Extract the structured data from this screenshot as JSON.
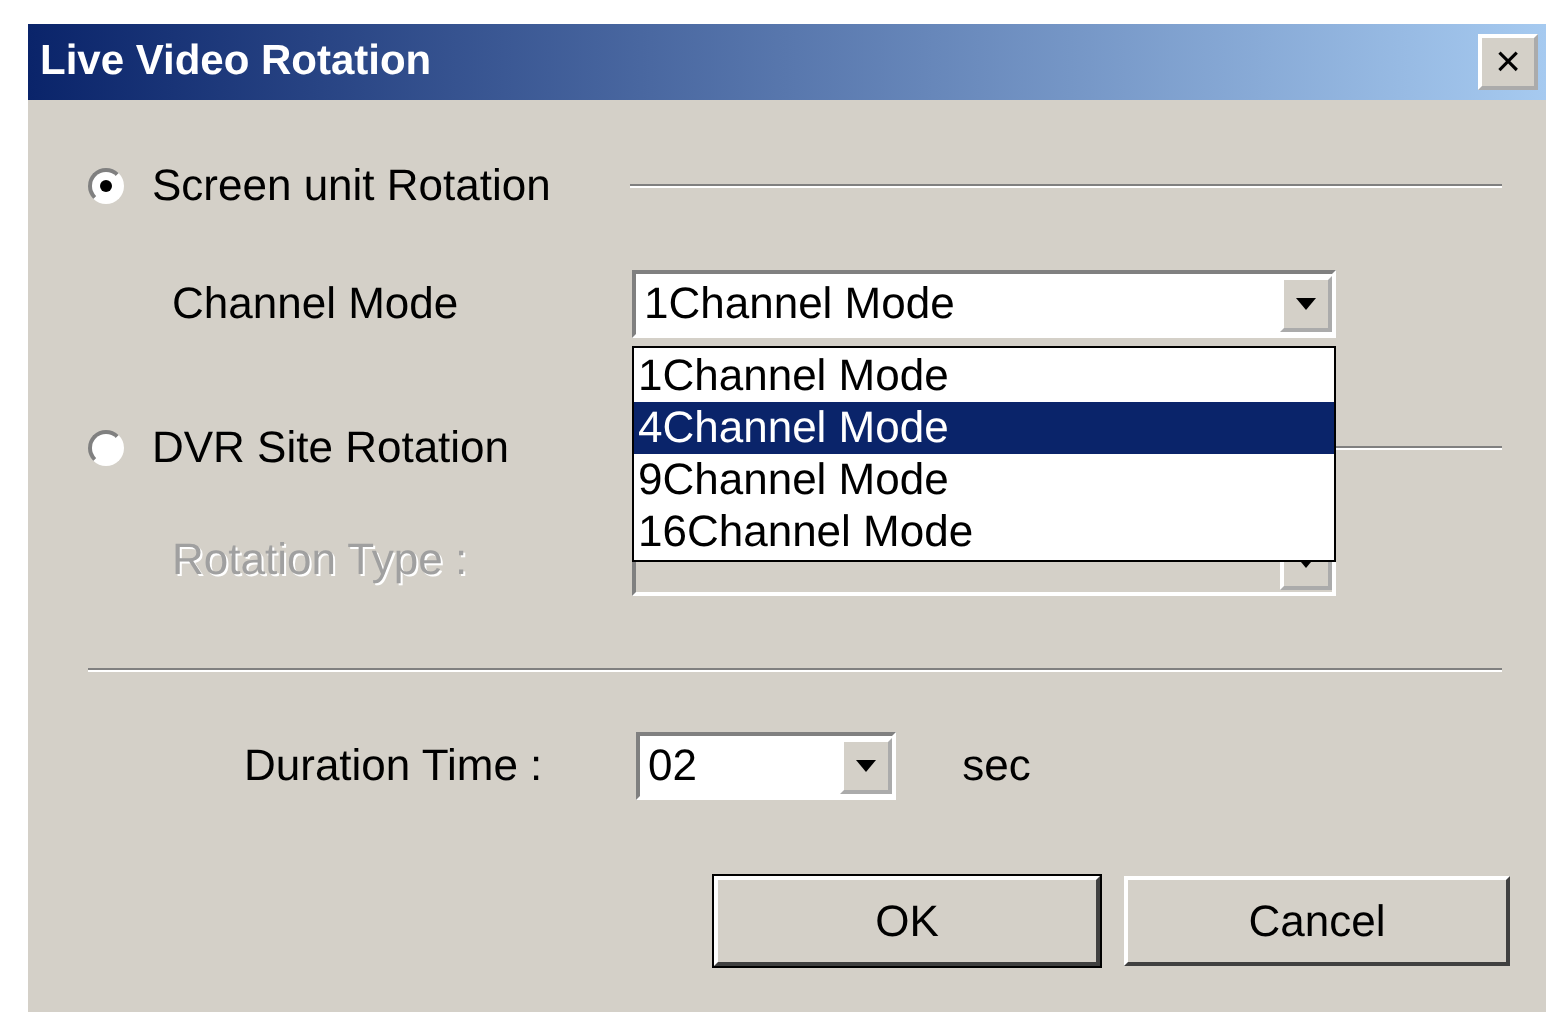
{
  "window": {
    "title": "Live Video Rotation",
    "close": "×"
  },
  "modes": [
    {
      "label": "Screen unit Rotation",
      "selected": true
    },
    {
      "label": "DVR Site Rotation",
      "selected": false
    }
  ],
  "channel_mode": {
    "label": "Channel Mode",
    "value": "1Channel Mode",
    "expanded": true,
    "options": [
      {
        "label": "1Channel Mode",
        "highlighted": false
      },
      {
        "label": "4Channel Mode",
        "highlighted": true
      },
      {
        "label": "9Channel Mode",
        "highlighted": false
      },
      {
        "label": "16Channel Mode",
        "highlighted": false
      }
    ]
  },
  "rotation_type": {
    "label": "Rotation Type :",
    "disabled": true
  },
  "duration": {
    "label": "Duration Time :",
    "value": "02",
    "unit": "sec"
  },
  "buttons": [
    "OK",
    "Cancel"
  ]
}
